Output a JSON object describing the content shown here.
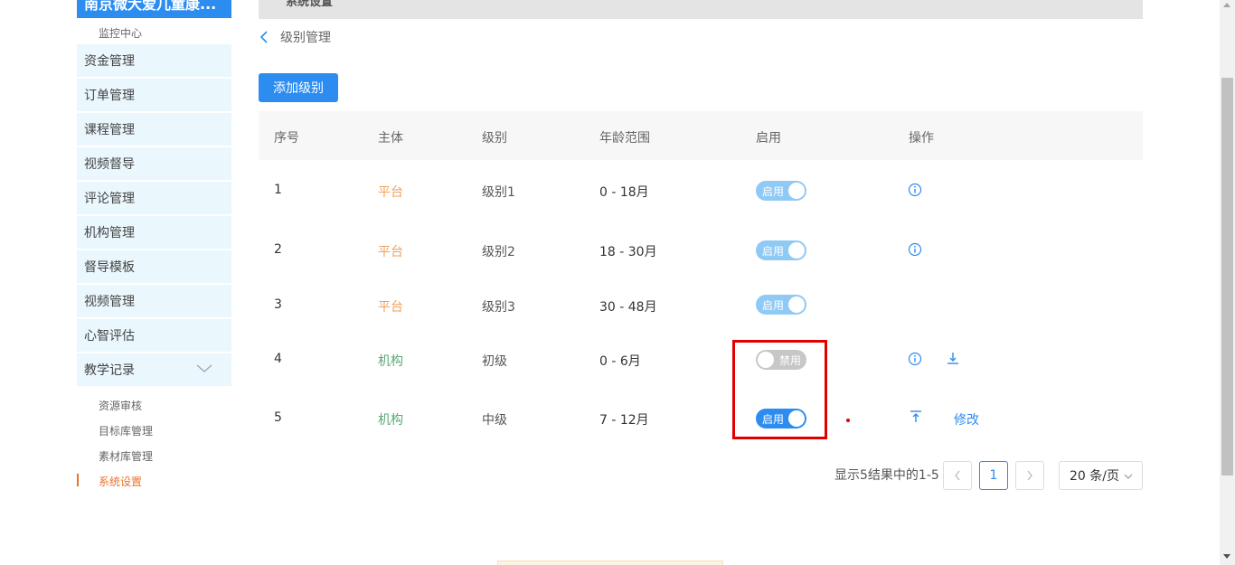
{
  "sidebar": {
    "brand": "南京微大爱儿童康...",
    "monitor": "监控中心",
    "items": [
      "资金管理",
      "订单管理",
      "课程管理",
      "视频督导",
      "评论管理",
      "机构管理",
      "督导模板",
      "视频管理",
      "心智评估",
      "教学记录"
    ],
    "subitems": [
      "资源审核",
      "目标库管理",
      "素材库管理",
      "系统设置"
    ],
    "active_subitem": "系统设置"
  },
  "header": {
    "title": "系统设置"
  },
  "breadcrumb": {
    "label": "级别管理"
  },
  "toolbar": {
    "add_label": "添加级别"
  },
  "table": {
    "columns": [
      "序号",
      "主体",
      "级别",
      "年龄范围",
      "启用",
      "操作"
    ],
    "rows": [
      {
        "no": "1",
        "subject": "平台",
        "level": "级别1",
        "age": "0 - 18月",
        "switch": "启用",
        "state": "on-light"
      },
      {
        "no": "2",
        "subject": "平台",
        "level": "级别2",
        "age": "18 - 30月",
        "switch": "启用",
        "state": "on-light"
      },
      {
        "no": "3",
        "subject": "平台",
        "level": "级别3",
        "age": "30 - 48月",
        "switch": "启用",
        "state": "on-light"
      },
      {
        "no": "4",
        "subject": "机构",
        "level": "初级",
        "age": "0 - 6月",
        "switch": "禁用",
        "state": "off"
      },
      {
        "no": "5",
        "subject": "机构",
        "level": "中级",
        "age": "7 - 12月",
        "switch": "启用",
        "state": "on"
      }
    ],
    "edit_label": "修改"
  },
  "pagination": {
    "info": "显示5结果中的1-5",
    "current_page": "1",
    "page_size": "20 条/页"
  },
  "colors": {
    "primary": "#2d8cf0",
    "platform": "#f0a05a",
    "org": "#5aa876",
    "highlight": "#e00000"
  }
}
